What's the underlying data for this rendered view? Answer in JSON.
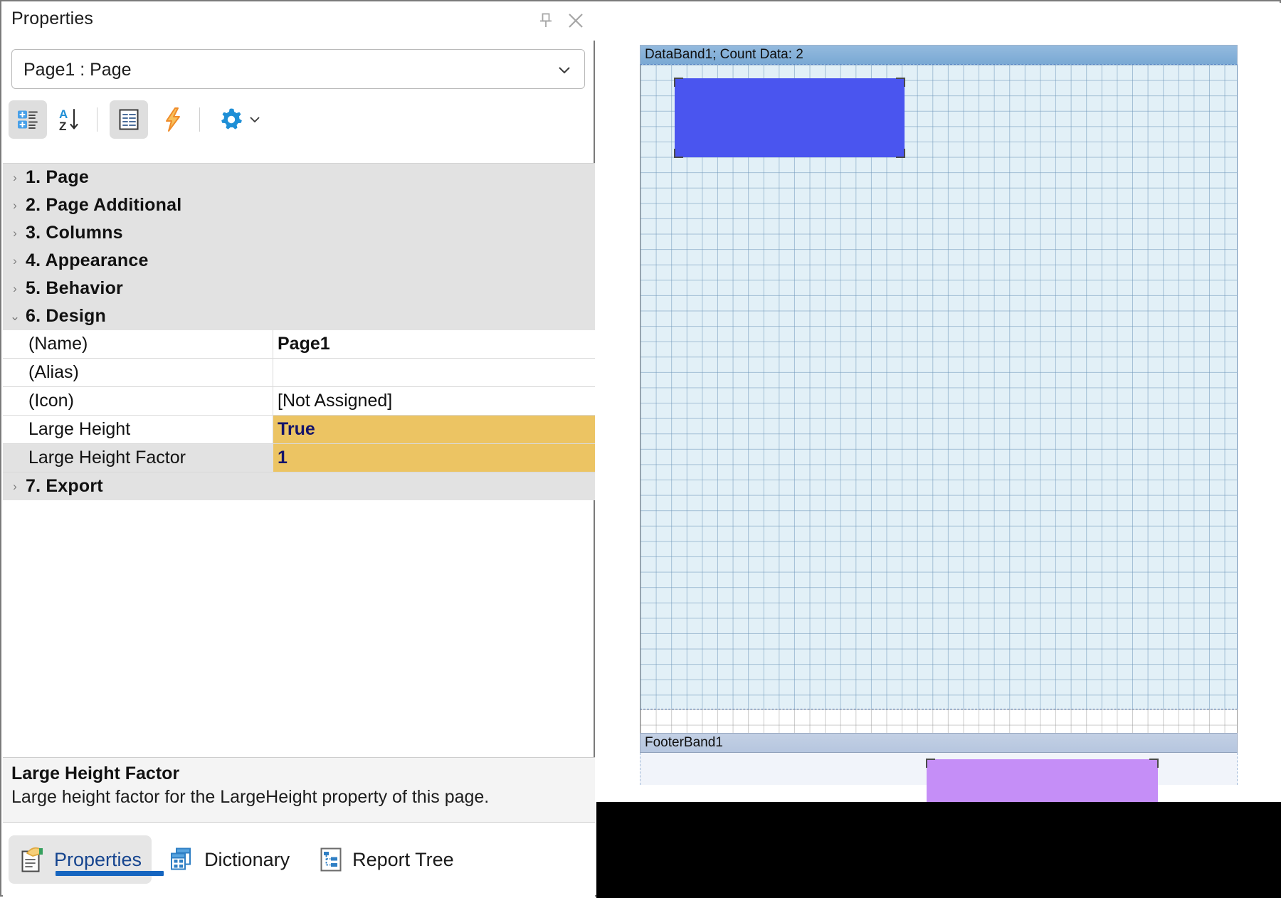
{
  "panel": {
    "title": "Properties",
    "pin_icon": "pin-icon",
    "close_icon": "close-icon"
  },
  "object_selector": {
    "value": "Page1 : Page",
    "chevron_icon": "chevron-down-icon"
  },
  "toolbar": {
    "buttons": [
      {
        "name": "categorized-view-button",
        "icon": "categorized-list-icon",
        "active": true
      },
      {
        "name": "alphabetical-sort-button",
        "icon": "sort-az-icon",
        "active": false
      },
      {
        "name": "property-pages-button",
        "icon": "property-pages-icon",
        "active": true
      },
      {
        "name": "events-button",
        "icon": "lightning-bolt-icon",
        "active": false
      },
      {
        "name": "settings-button",
        "icon": "gear-icon",
        "active": false
      }
    ]
  },
  "property_grid": {
    "categories": [
      {
        "index": "1.",
        "label": "1. Page",
        "expanded": false
      },
      {
        "index": "2.",
        "label": "2. Page  Additional",
        "expanded": false
      },
      {
        "index": "3.",
        "label": "3. Columns",
        "expanded": false
      },
      {
        "index": "4.",
        "label": "4. Appearance",
        "expanded": false
      },
      {
        "index": "5.",
        "label": "5. Behavior",
        "expanded": false
      },
      {
        "index": "6.",
        "label": "6. Design",
        "expanded": true
      },
      {
        "index": "7.",
        "label": "7. Export",
        "expanded": false
      }
    ],
    "design_rows": [
      {
        "name": "(Name)",
        "value": "Page1",
        "bold": true,
        "highlight": false
      },
      {
        "name": "(Alias)",
        "value": "",
        "bold": false,
        "highlight": false
      },
      {
        "name": "(Icon)",
        "value": "[Not Assigned]",
        "bold": false,
        "highlight": false
      },
      {
        "name": "Large Height",
        "value": "True",
        "bold": true,
        "highlight": true
      },
      {
        "name": "Large Height Factor",
        "value": "1",
        "bold": true,
        "highlight": true
      }
    ],
    "selected_row": "Large Height Factor",
    "highlight_color": "#ecc463"
  },
  "description": {
    "title": "Large Height Factor",
    "text": "Large height factor for the LargeHeight property of this page."
  },
  "bottom_tabs": [
    {
      "label": "Properties",
      "icon": "properties-hand-page-icon",
      "active": true
    },
    {
      "label": "Dictionary",
      "icon": "dictionary-table-icon",
      "active": false
    },
    {
      "label": "Report Tree",
      "icon": "report-tree-icon",
      "active": false
    }
  ],
  "designer": {
    "bands": [
      {
        "name": "DataBand1",
        "header_text": "DataBand1; Count Data: 2",
        "color": "#7aa9d4"
      },
      {
        "name": "FooterBand1",
        "header_text": "FooterBand1",
        "color": "#b6c6df"
      }
    ],
    "components": [
      {
        "name": "blue-component",
        "color": "#4a55ef",
        "band": "DataBand1",
        "selected": true
      },
      {
        "name": "purple-component",
        "color": "#c58ef7",
        "band": "FooterBand1",
        "selected": true
      }
    ]
  }
}
